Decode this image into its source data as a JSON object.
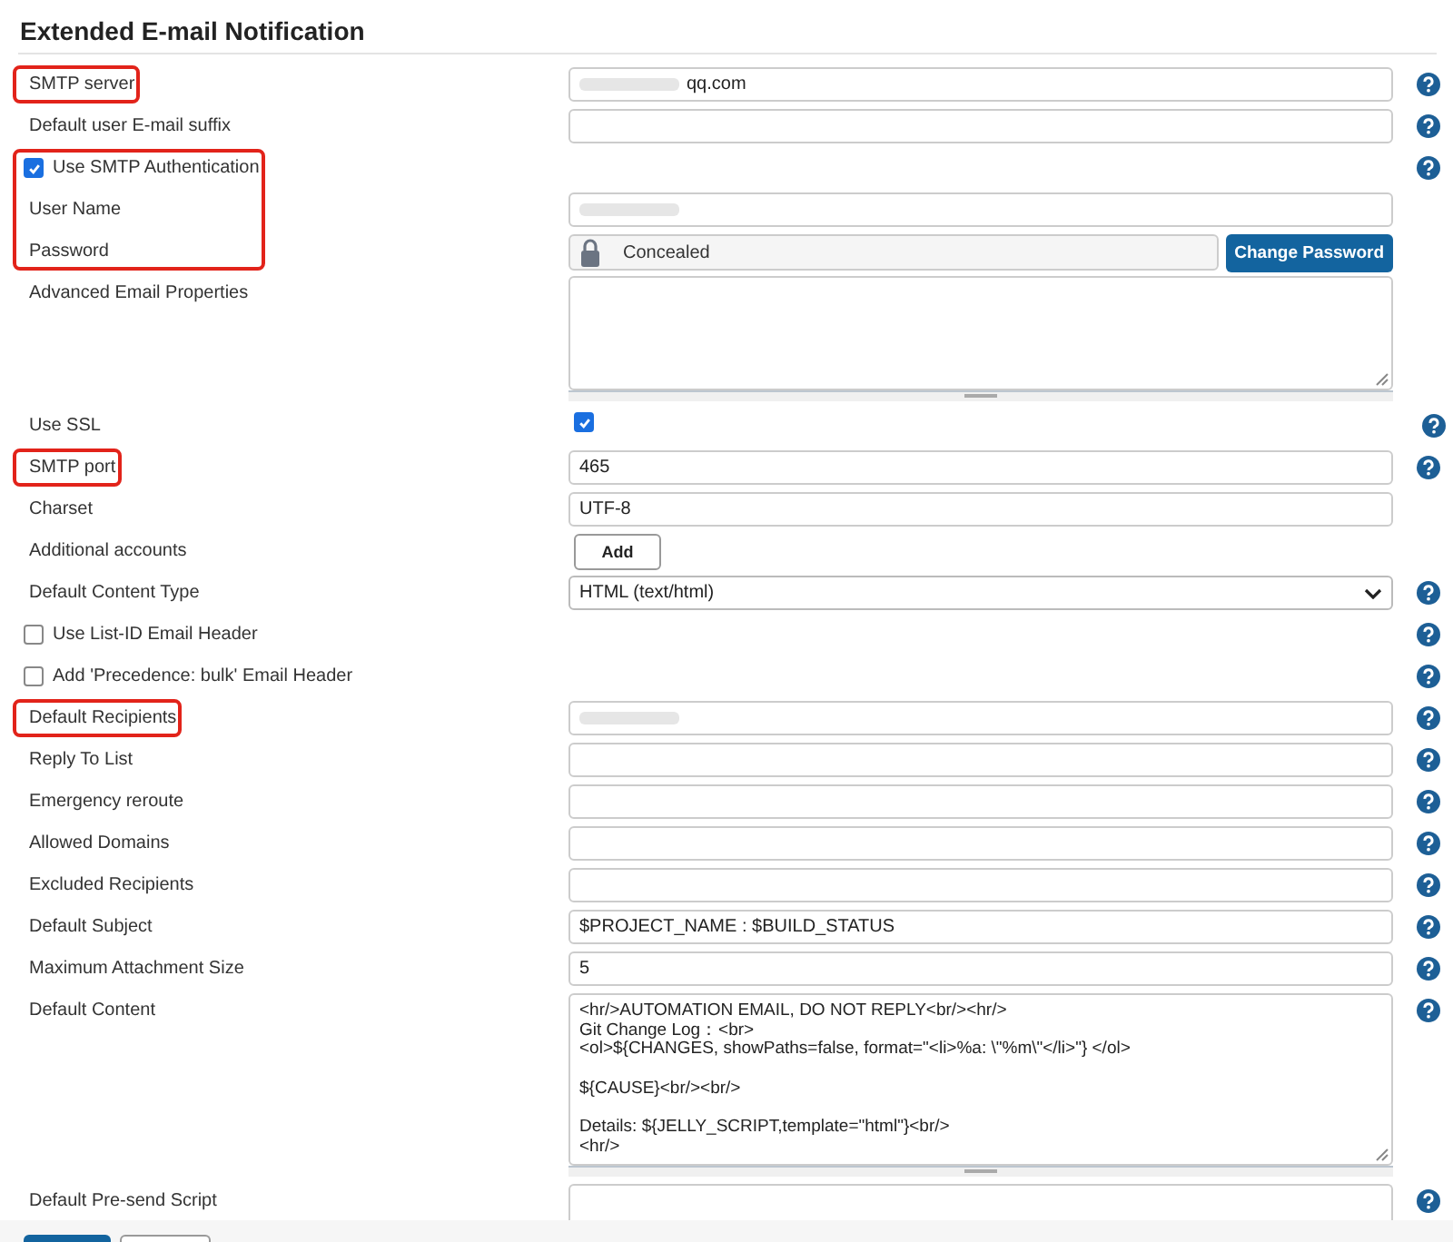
{
  "section_title": "Extended E-mail Notification",
  "rows": [
    {
      "kind": "text",
      "label": "SMTP server",
      "value": "qq.com",
      "redacted": true,
      "highlighted": true,
      "help": true
    },
    {
      "kind": "text",
      "label": "Default user E-mail suffix",
      "highlighted": false,
      "help": true
    },
    {
      "kind": "check-label",
      "label": "Use SMTP Authentication",
      "checked": true,
      "highlighted": true,
      "help": true
    },
    {
      "kind": "text",
      "label": "User Name",
      "redacted": true,
      "highlighted": true,
      "help": false
    },
    {
      "kind": "password",
      "label": "Password",
      "value": "Concealed",
      "button": "Change Password",
      "highlighted": true,
      "help": false
    },
    {
      "kind": "textarea",
      "label": "Advanced Email Properties",
      "highlighted": false,
      "help": false
    },
    {
      "kind": "check-field",
      "label": "Use SSL",
      "checked": true,
      "highlighted": false,
      "help": true
    },
    {
      "kind": "text",
      "label": "SMTP port",
      "value": "465",
      "highlighted": true,
      "help": true
    },
    {
      "kind": "text",
      "label": "Charset",
      "value": "UTF-8",
      "highlighted": false,
      "help": false
    },
    {
      "kind": "button",
      "label": "Additional accounts",
      "button": "Add",
      "highlighted": false,
      "help": false
    },
    {
      "kind": "select",
      "label": "Default Content Type",
      "value": "HTML (text/html)",
      "highlighted": false,
      "help": true
    },
    {
      "kind": "check-label",
      "label": "Use List-ID Email Header",
      "checked": false,
      "highlighted": false,
      "help": true
    },
    {
      "kind": "check-label",
      "label": "Add 'Precedence: bulk' Email Header",
      "checked": false,
      "highlighted": false,
      "help": true
    },
    {
      "kind": "text",
      "label": "Default Recipients",
      "redacted": true,
      "highlighted": true,
      "help": true
    },
    {
      "kind": "text",
      "label": "Reply To List",
      "highlighted": false,
      "help": true
    },
    {
      "kind": "text",
      "label": "Emergency reroute",
      "highlighted": false,
      "help": true
    },
    {
      "kind": "text",
      "label": "Allowed Domains",
      "highlighted": false,
      "help": true
    },
    {
      "kind": "text",
      "label": "Excluded Recipients",
      "highlighted": false,
      "help": true
    },
    {
      "kind": "text",
      "label": "Default Subject",
      "value": "$PROJECT_NAME : $BUILD_STATUS",
      "highlighted": false,
      "help": true
    },
    {
      "kind": "text",
      "label": "Maximum Attachment Size",
      "value": "5",
      "highlighted": false,
      "help": true
    },
    {
      "kind": "textarea",
      "label": "Default Content",
      "value": "<hr/>AUTOMATION EMAIL, DO NOT REPLY<br/><hr/>\nGit Change Log：<br>\n<ol>${CHANGES, showPaths=false, format=\"<li>%a: \\\"%m\\\"</li>\"} </ol>\n\n${CAUSE}<br/><br/>\n\nDetails: ${JELLY_SCRIPT,template=\"html\"}<br/>\n<hr/>",
      "highlighted": false,
      "help": true
    },
    {
      "kind": "textarea-cut",
      "label": "Default Pre-send Script",
      "highlighted": false,
      "help": true
    }
  ]
}
